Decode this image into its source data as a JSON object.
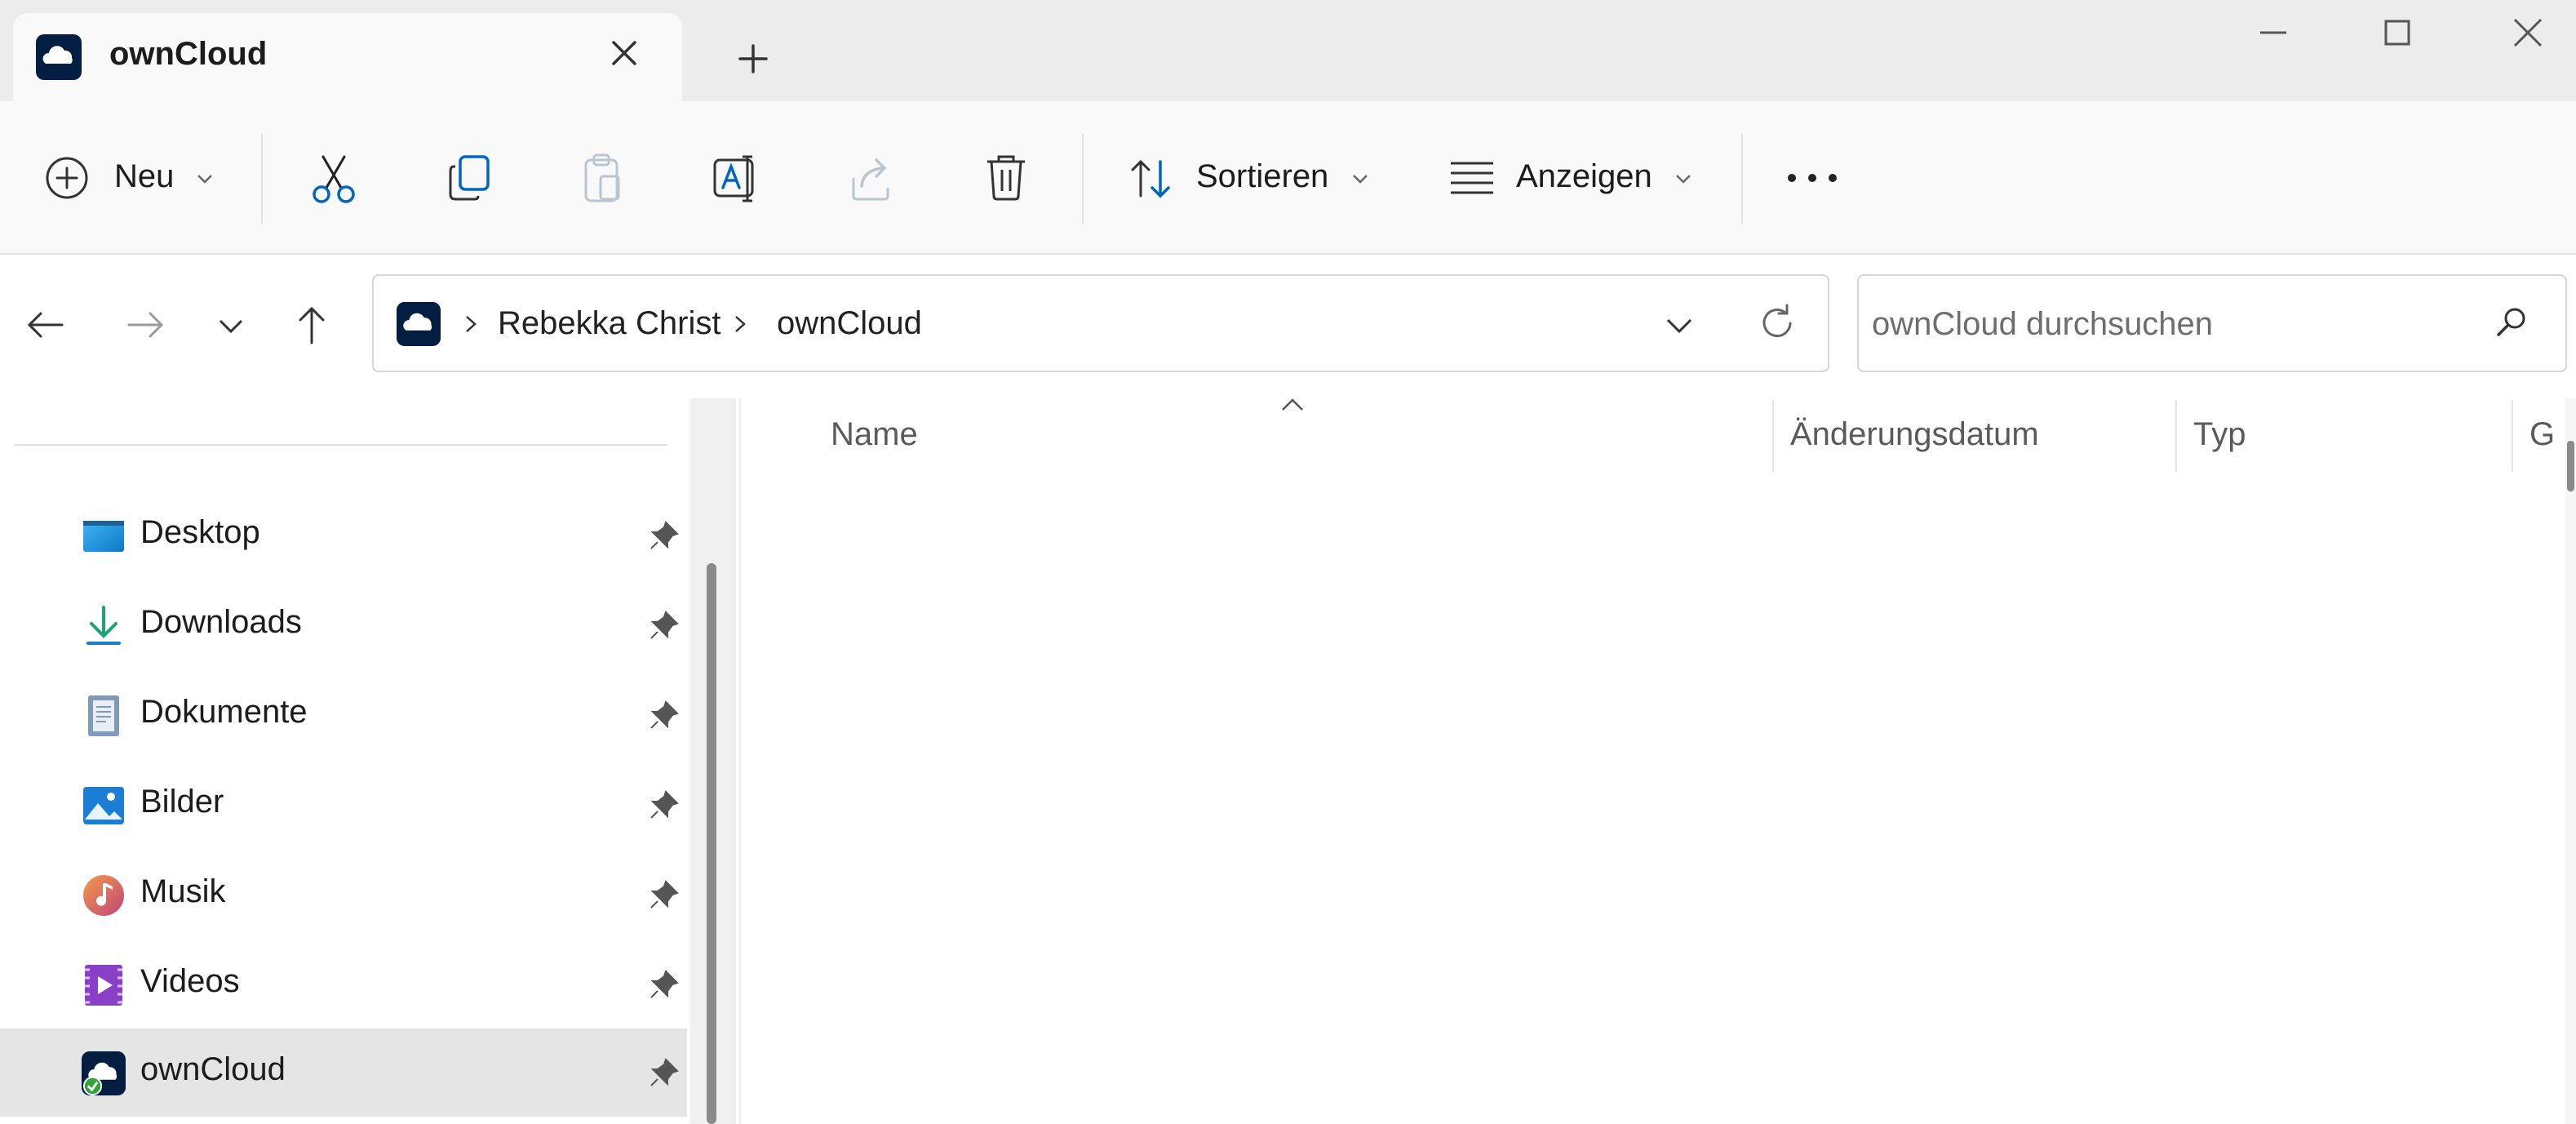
{
  "tab": {
    "title": "ownCloud"
  },
  "toolbar": {
    "new_label": "Neu",
    "sort_label": "Sortieren",
    "view_label": "Anzeigen"
  },
  "address": {
    "crumbs": [
      "Rebekka Christ",
      "ownCloud"
    ]
  },
  "search": {
    "placeholder": "ownCloud durchsuchen"
  },
  "sidebar": {
    "items": [
      {
        "label": "Desktop",
        "icon": "desktop-icon",
        "pinned": true
      },
      {
        "label": "Downloads",
        "icon": "download-icon",
        "pinned": true
      },
      {
        "label": "Dokumente",
        "icon": "document-icon",
        "pinned": true
      },
      {
        "label": "Bilder",
        "icon": "pictures-icon",
        "pinned": true
      },
      {
        "label": "Musik",
        "icon": "music-icon",
        "pinned": true
      },
      {
        "label": "Videos",
        "icon": "video-icon",
        "pinned": true
      },
      {
        "label": "ownCloud",
        "icon": "owncloud-icon",
        "pinned": true,
        "selected": true
      }
    ]
  },
  "columns": {
    "name": "Name",
    "date": "Änderungsdatum",
    "type": "Typ",
    "size": "G"
  },
  "colors": {
    "accent": "#005fb8",
    "owncloud_brand": "#041e42",
    "selected_bg": "#e5e5e5"
  }
}
